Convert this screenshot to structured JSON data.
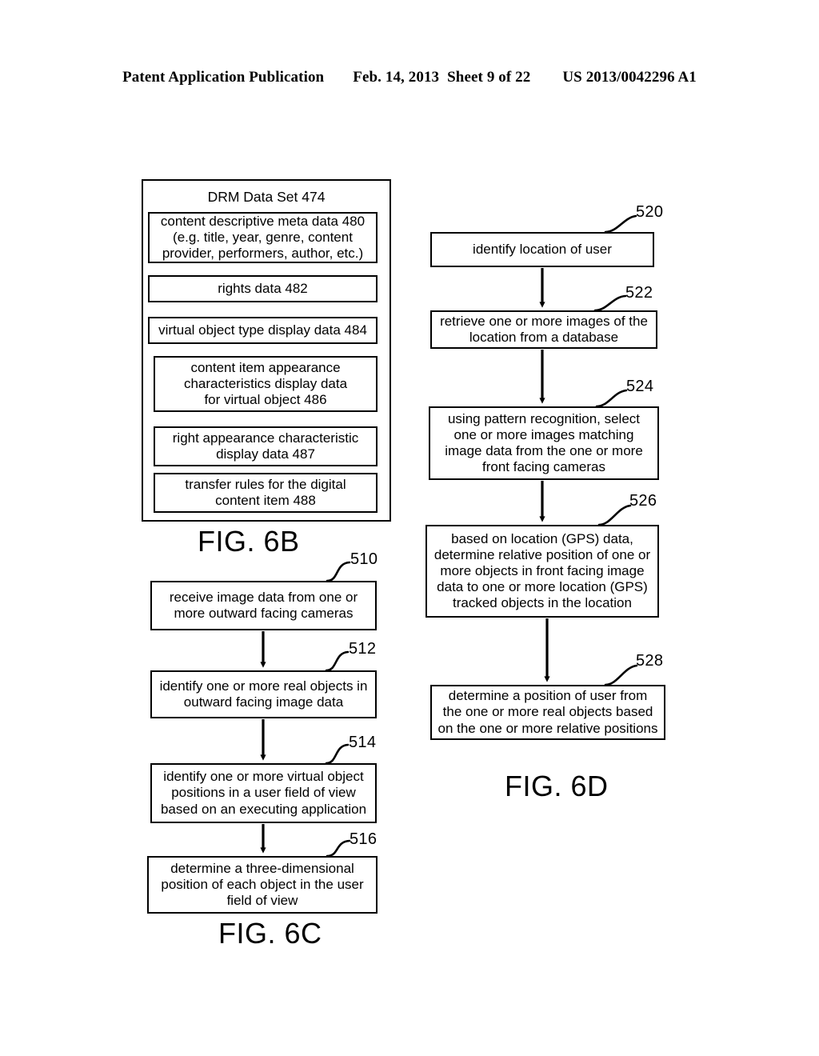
{
  "header": {
    "publication": "Patent Application Publication",
    "date": "Feb. 14, 2013",
    "sheet": "Sheet 9 of 22",
    "patent_number": "US 2013/0042296 A1"
  },
  "fig6b": {
    "caption": "FIG. 6B",
    "title": "DRM Data Set 474",
    "items": [
      {
        "ref": "480",
        "text": "content descriptive meta data 480\n(e.g. title, year, genre, content\nprovider, performers, author, etc.)"
      },
      {
        "ref": "482",
        "text": "rights data 482"
      },
      {
        "ref": "484",
        "text": "virtual object type display data 484"
      },
      {
        "ref": "486",
        "text": "content item appearance\ncharacteristics display data\nfor virtual object  486"
      },
      {
        "ref": "487",
        "text": "right appearance characteristic\ndisplay data 487"
      },
      {
        "ref": "488",
        "text": "transfer rules for the digital\ncontent item 488"
      }
    ]
  },
  "fig6c": {
    "caption": "FIG. 6C",
    "steps": [
      {
        "ref": "510",
        "text": "receive image data from one or\nmore outward facing cameras"
      },
      {
        "ref": "512",
        "text": "identify one or more real objects in\noutward facing image data"
      },
      {
        "ref": "514",
        "text": "identify one or more virtual object\npositions in a user field of view\nbased on an executing application"
      },
      {
        "ref": "516",
        "text": "determine a three-dimensional\nposition of each object in the user\nfield of view"
      }
    ]
  },
  "fig6d": {
    "caption": "FIG. 6D",
    "steps": [
      {
        "ref": "520",
        "text": "identify location of user"
      },
      {
        "ref": "522",
        "text": "retrieve one or more images of the\nlocation from a database"
      },
      {
        "ref": "524",
        "text": "using pattern recognition, select\none or more images matching\nimage data from the one or more\nfront facing cameras"
      },
      {
        "ref": "526",
        "text": "based on location (GPS) data,\ndetermine relative position of one or\nmore objects in front facing image\ndata to one or more location (GPS)\ntracked objects in the location"
      },
      {
        "ref": "528",
        "text": "determine a position of user from\nthe one or more real objects based\non the one or more relative positions"
      }
    ]
  },
  "colors": {
    "ink": "#000000",
    "paper": "#ffffff"
  }
}
